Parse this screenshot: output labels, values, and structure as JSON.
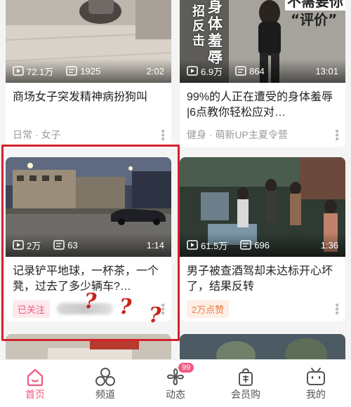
{
  "cards": [
    {
      "views": "72.1万",
      "danmaku": "1925",
      "duration": "2:02",
      "title": "商场女子突发精神病扮狗叫",
      "meta": "日常 · 女子"
    },
    {
      "views": "6.9万",
      "danmaku": "864",
      "duration": "13:01",
      "title": "99%的人正在遭受的身体羞辱 |6点教你轻松应对…",
      "meta": "健身 · 萌新UP主夏令营",
      "cover_text": {
        "left_col": "招反击",
        "mid_col": "身体羞辱",
        "right_top": "不需要你",
        "right_quote": "“评价”"
      }
    },
    {
      "views": "2万",
      "danmaku": "63",
      "duration": "1:14",
      "title": "记录铲平地球，一杯茶，一个凳，过去了多少辆车?…",
      "tag": "已关注"
    },
    {
      "views": "61.5万",
      "danmaku": "696",
      "duration": "1:36",
      "title": "男子被查酒驾却未达标开心坏了，结果反转",
      "tag": "2万点赞"
    }
  ],
  "annotation": {
    "marks": [
      "?",
      "?",
      "?"
    ]
  },
  "tabbar": {
    "items": [
      {
        "label": "首页",
        "icon": "home-icon",
        "active": true
      },
      {
        "label": "频道",
        "icon": "channel-icon"
      },
      {
        "label": "动态",
        "icon": "dynamic-icon",
        "badge": "99"
      },
      {
        "label": "会员购",
        "icon": "shopping-bag-icon"
      },
      {
        "label": "我的",
        "icon": "tv-icon"
      }
    ]
  },
  "colors": {
    "accent": "#f0597f",
    "annotation_red": "#d4212b",
    "tag_orange": "#ee7a40"
  }
}
